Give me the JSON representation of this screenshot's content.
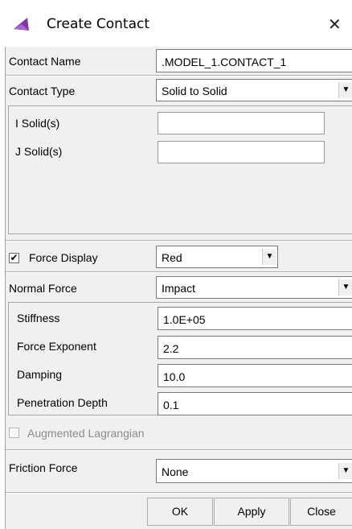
{
  "window": {
    "title": "Create Contact",
    "icon": "adams-app-icon",
    "close_glyph": "✕"
  },
  "contact_name": {
    "label": "Contact Name",
    "value": ".MODEL_1.CONTACT_1"
  },
  "contact_type": {
    "label": "Contact Type",
    "selected": "Solid to Solid"
  },
  "solids": {
    "i_label": "I Solid(s)",
    "i_value": "",
    "j_label": "J Solid(s)",
    "j_value": ""
  },
  "force_display": {
    "label": "Force Display",
    "checked": true,
    "check_glyph": "✔",
    "selected": "Red"
  },
  "normal_force": {
    "label": "Normal Force",
    "selected": "Impact"
  },
  "params": {
    "stiffness_label": "Stiffness",
    "stiffness": "1.0E+05",
    "exponent_label": "Force Exponent",
    "exponent": "2.2",
    "damping_label": "Damping",
    "damping": "10.0",
    "penetration_label": "Penetration Depth",
    "penetration": "0.1"
  },
  "augmented": {
    "label": "Augmented Lagrangian",
    "checked": false,
    "enabled": false
  },
  "friction_force": {
    "label": "Friction Force",
    "selected": "None"
  },
  "dropdown_glyph": "▼",
  "buttons": {
    "ok": "OK",
    "apply": "Apply",
    "close": "Close"
  }
}
